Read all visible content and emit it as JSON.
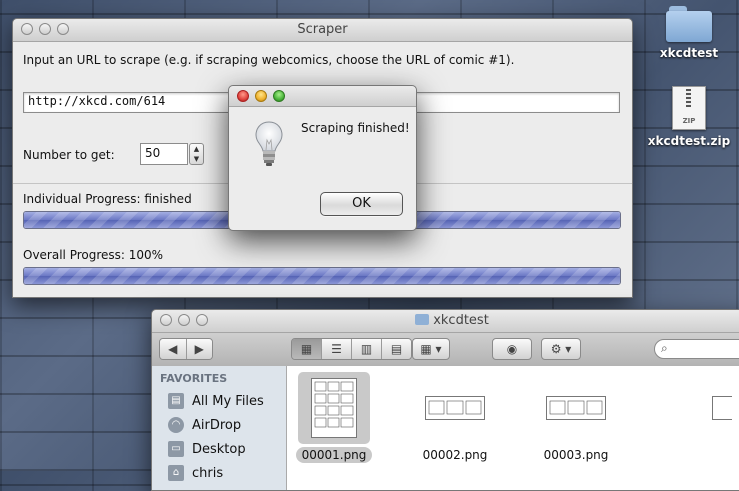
{
  "desktop": {
    "folder_label": "xkcdtest",
    "zip_label": "xkcdtest.zip",
    "zip_icon_text": "ZIP"
  },
  "scraper": {
    "title": "Scraper",
    "instruction": "Input an URL to scrape (e.g. if scraping webcomics, choose the URL of comic #1).",
    "url_value": "http://xkcd.com/614",
    "number_label": "Number to get:",
    "number_value": "50",
    "individual_label": "Individual Progress: finished",
    "individual_progress": 1.0,
    "overall_label": "Overall Progress: 100%",
    "overall_progress": 1.0
  },
  "dialog": {
    "message": "Scraping finished!",
    "ok_label": "OK"
  },
  "finder": {
    "title": "xkcdtest",
    "sidebar_heading": "FAVORITES",
    "sidebar_items": [
      {
        "label": "All My Files",
        "icon": "all-files-icon"
      },
      {
        "label": "AirDrop",
        "icon": "airdrop-icon"
      },
      {
        "label": "Desktop",
        "icon": "desktop-icon"
      },
      {
        "label": "chris",
        "icon": "home-icon"
      }
    ],
    "files": [
      {
        "name": "00001.png",
        "selected": true
      },
      {
        "name": "00002.png",
        "selected": false
      },
      {
        "name": "00003.png",
        "selected": false
      }
    ]
  }
}
